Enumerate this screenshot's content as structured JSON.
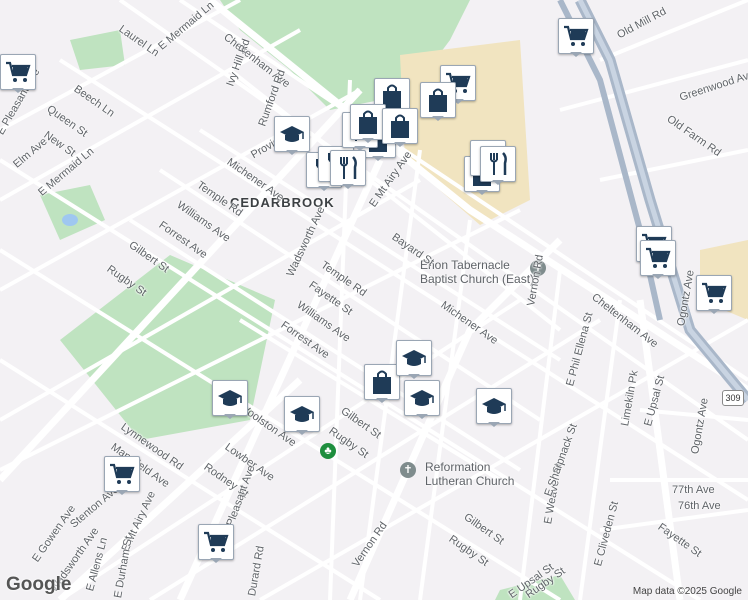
{
  "map": {
    "neighborhood": "CEDARBROOK",
    "route_shield": "309",
    "attribution": "Map data ©2025 Google",
    "logo": "Google",
    "places": [
      {
        "name": "Enon Tabernacle\nBaptist Church (East)"
      },
      {
        "name": "Reformation\nLutheran Church"
      }
    ],
    "streets": [
      "Cheltenham Ave",
      "Laurel Ln",
      "E Mermaid Ln",
      "Ivy Hill Rd",
      "Beech Ln",
      "Queen St",
      "New St",
      "E Pleasant Ave",
      "Elm Ave",
      "E Mermaid Ln",
      "Rumford Rd",
      "Provident St",
      "Michener Ave",
      "Temple Rd",
      "Williams Ave",
      "Forrest Ave",
      "Gilbert St",
      "Rugby St",
      "Wadsworth Ave",
      "Temple Rd",
      "Fayette St",
      "Williams Ave",
      "Forrest Ave",
      "E Mt Airy Ave",
      "Bayard St",
      "Michener Ave",
      "Vernon Rd",
      "Cheltenham Ave",
      "Limekiln Pk",
      "E Phil Ellena St",
      "Ogontz Ave",
      "E Upsal St",
      "Ogontz Ave",
      "Old Mill Rd",
      "Greenwood Ave",
      "Old Farm Rd",
      "Lynnewood Rd",
      "Mansfield Ave",
      "Rodney St",
      "Lowber Ave",
      "Woolston Ave",
      "Gilbert St",
      "Rugby St",
      "E Gowen Ave",
      "Wadsworth Ave",
      "E Allens Ln",
      "E Mt Airy Ave",
      "E Durham St",
      "Durard Rd",
      "Stenton Ave",
      "Vernon Rd",
      "Gilbert St",
      "Rugby St",
      "E Upsal St",
      "Rugby St",
      "E Weaver St",
      "E Sharpnack St",
      "77th Ave",
      "76th Ave",
      "Fayette St",
      "E Cliveden St",
      "Pleasant Ave"
    ],
    "markers": [
      {
        "icon": "shopping-cart-icon"
      },
      {
        "icon": "shopping-cart-icon"
      },
      {
        "icon": "shopping-cart-icon"
      },
      {
        "icon": "shopping-cart-icon"
      },
      {
        "icon": "shopping-cart-icon"
      },
      {
        "icon": "shopping-cart-icon"
      },
      {
        "icon": "shopping-cart-icon"
      },
      {
        "icon": "shopping-cart-icon"
      },
      {
        "icon": "shopping-bag-icon"
      },
      {
        "icon": "shopping-bag-icon"
      },
      {
        "icon": "shopping-bag-icon"
      },
      {
        "icon": "shopping-bag-icon"
      },
      {
        "icon": "shopping-bag-icon"
      },
      {
        "icon": "school-icon"
      },
      {
        "icon": "school-icon"
      },
      {
        "icon": "school-icon"
      },
      {
        "icon": "school-icon"
      },
      {
        "icon": "school-icon"
      },
      {
        "icon": "school-icon"
      },
      {
        "icon": "restaurant-icon"
      },
      {
        "icon": "restaurant-icon"
      }
    ]
  }
}
